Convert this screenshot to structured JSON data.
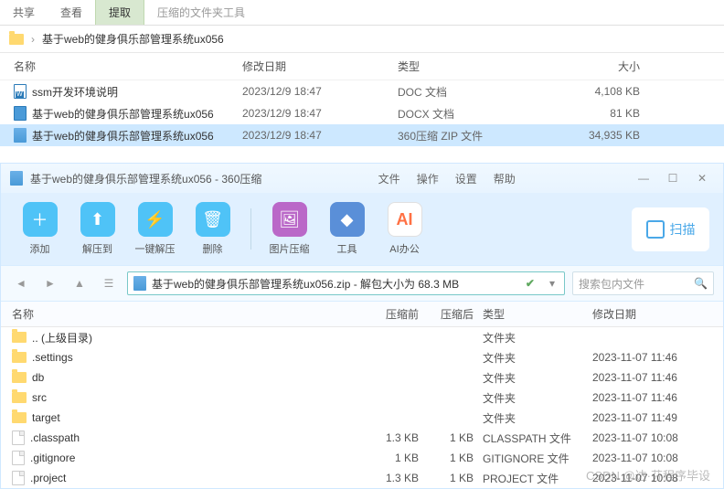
{
  "explorer": {
    "tabs": {
      "share": "共享",
      "view": "查看",
      "extract": "提取",
      "tools": "压缩的文件夹工具"
    },
    "breadcrumb": {
      "sep": "›",
      "folder": "基于web的健身俱乐部管理系统ux056"
    },
    "cols": {
      "name": "名称",
      "date": "修改日期",
      "type": "类型",
      "size": "大小"
    },
    "rows": [
      {
        "name": "ssm开发环境说明",
        "date": "2023/12/9 18:47",
        "type": "DOC 文档",
        "size": "4,108 KB",
        "icon": "doc"
      },
      {
        "name": "基于web的健身俱乐部管理系统ux056",
        "date": "2023/12/9 18:47",
        "type": "DOCX 文档",
        "size": "81 KB",
        "icon": "docx"
      },
      {
        "name": "基于web的健身俱乐部管理系统ux056",
        "date": "2023/12/9 18:47",
        "type": "360压缩 ZIP 文件",
        "size": "34,935 KB",
        "icon": "zip",
        "selected": true
      }
    ]
  },
  "zip": {
    "title": "基于web的健身俱乐部管理系统ux056 - 360压缩",
    "menu": {
      "file": "文件",
      "action": "操作",
      "settings": "设置",
      "help": "帮助"
    },
    "toolbar": {
      "add": "添加",
      "extract": "解压到",
      "oneclick": "一键解压",
      "delete": "删除",
      "img": "图片压缩",
      "tool": "工具",
      "ai": "AI办公",
      "scan": "扫描"
    },
    "nav": {
      "path": "基于web的健身俱乐部管理系统ux056.zip - 解包大小为 68.3 MB",
      "search_placeholder": "搜索包内文件"
    },
    "cols": {
      "name": "名称",
      "before": "压缩前",
      "after": "压缩后",
      "type": "类型",
      "date": "修改日期"
    },
    "rows": [
      {
        "name": ".. (上级目录)",
        "before": "",
        "after": "",
        "type": "文件夹",
        "date": "",
        "icon": "folder"
      },
      {
        "name": ".settings",
        "before": "",
        "after": "",
        "type": "文件夹",
        "date": "2023-11-07 11:46",
        "icon": "folder"
      },
      {
        "name": "db",
        "before": "",
        "after": "",
        "type": "文件夹",
        "date": "2023-11-07 11:46",
        "icon": "folder"
      },
      {
        "name": "src",
        "before": "",
        "after": "",
        "type": "文件夹",
        "date": "2023-11-07 11:46",
        "icon": "folder"
      },
      {
        "name": "target",
        "before": "",
        "after": "",
        "type": "文件夹",
        "date": "2023-11-07 11:49",
        "icon": "folder"
      },
      {
        "name": ".classpath",
        "before": "1.3 KB",
        "after": "1 KB",
        "type": "CLASSPATH 文件",
        "date": "2023-11-07 10:08",
        "icon": "file"
      },
      {
        "name": ".gitignore",
        "before": "1 KB",
        "after": "1 KB",
        "type": "GITIGNORE 文件",
        "date": "2023-11-07 10:08",
        "icon": "file"
      },
      {
        "name": ".project",
        "before": "1.3 KB",
        "after": "1 KB",
        "type": "PROJECT 文件",
        "date": "2023-11-07 10:08",
        "icon": "file"
      }
    ]
  },
  "watermark": "CSDN @达·芬程序毕设"
}
